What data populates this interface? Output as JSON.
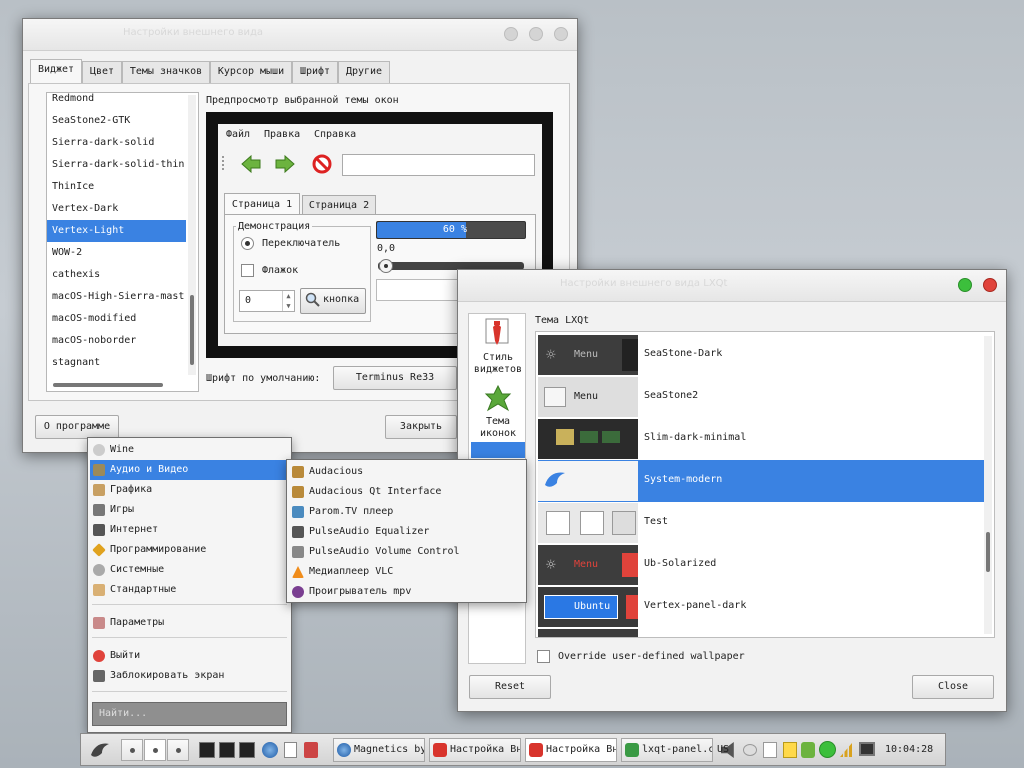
{
  "gtk_window": {
    "title": "Настройки внешнего вида",
    "tabs": [
      "Виджет",
      "Цвет",
      "Темы значков",
      "Курсор мыши",
      "Шрифт",
      "Другие"
    ],
    "themes": [
      "Redmond",
      "SeaStone2-GTK",
      "Sierra-dark-solid",
      "Sierra-dark-solid-thin",
      "ThinIce",
      "Vertex-Dark",
      "Vertex-Light",
      "WOW-2",
      "cathexis",
      "macOS-High-Sierra-mast",
      "macOS-modified",
      "macOS-noborder",
      "stagnant"
    ],
    "selected_theme": "Vertex-Light",
    "preview_label": "Предпросмотр выбранной темы окон",
    "preview": {
      "menu": [
        "Файл",
        "Правка",
        "Справка"
      ],
      "tabs": [
        "Страница 1",
        "Страница 2"
      ],
      "group_label": "Демонстрация",
      "radio_label": "Переключатель",
      "check_label": "Флажок",
      "spin_value": "0",
      "button_label": "кнопка",
      "progress_text": "60 %",
      "progress": 0.6,
      "scale_value": "0,0"
    },
    "font_label": "Шрифт по умолчанию:",
    "font_value": "Terminus Re33",
    "about_button": "О программе",
    "close_button": "Закрыть"
  },
  "lxqt_window": {
    "title": "Настройки внешнего вида LXQt",
    "sidebar": [
      {
        "label": "Стиль виджетов",
        "icon": "widget-style-icon"
      },
      {
        "label": "Тема иконок",
        "icon": "icon-theme-icon"
      }
    ],
    "section_label": "Тема LXQt",
    "themes": [
      {
        "name": "SeaStone-Dark",
        "thumb_text": "Menu"
      },
      {
        "name": "SeaStone2",
        "thumb_text": "Menu"
      },
      {
        "name": "Slim-dark-minimal",
        "thumb_text": ""
      },
      {
        "name": "System-modern",
        "thumb_text": ""
      },
      {
        "name": "Test",
        "thumb_text": ""
      },
      {
        "name": "Ub-Solarized",
        "thumb_text": "Menu"
      },
      {
        "name": "Vertex-panel-dark",
        "thumb_text": "Ubuntu"
      }
    ],
    "selected_theme": "System-modern",
    "override_label": "Override user-defined wallpaper",
    "reset_button": "Reset",
    "close_button": "Close"
  },
  "start_menu": {
    "items": [
      "Wine",
      "Аудио и Видео",
      "Графика",
      "Игры",
      "Интернет",
      "Программирование",
      "Системные",
      "Стандартные"
    ],
    "selected": "Аудио и Видео",
    "settings": "Параметры",
    "logout": "Выйти",
    "lock": "Заблокировать экран",
    "search_placeholder": "Найти..."
  },
  "submenu": {
    "items": [
      "Audacious",
      "Audacious Qt Interface",
      "Parom.TV плеер",
      "PulseAudio Equalizer",
      "PulseAudio Volume Control",
      "Медиаплеер VLC",
      "Проигрыватель mpv"
    ]
  },
  "taskbar": {
    "tasks": [
      "Magnetics by",
      "Настройка Вн",
      "Настройка Вн",
      "lxqt-panel.c"
    ],
    "keyboard_layout": "US",
    "clock": "10:04:28"
  },
  "colors": {
    "accent": "#3a82e2",
    "close_red": "#e0433b",
    "max_green": "#3cbf3c"
  }
}
